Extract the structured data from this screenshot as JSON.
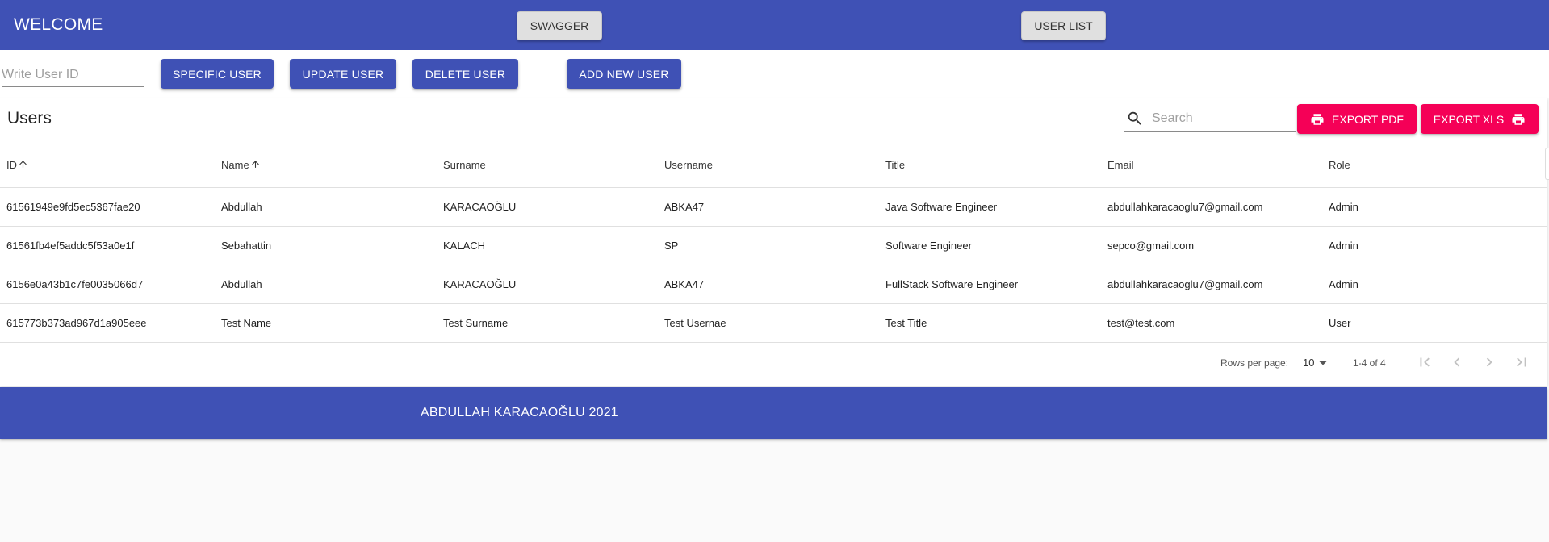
{
  "header": {
    "brand": "WELCOME",
    "swagger_label": "SWAGGER",
    "user_list_label": "USER LIST"
  },
  "actions": {
    "user_id_placeholder": "Write User ID",
    "specific_user_label": "SPECIFIC USER",
    "update_user_label": "UPDATE USER",
    "delete_user_label": "DELETE USER",
    "add_new_user_label": "ADD NEW USER"
  },
  "table_panel": {
    "title": "Users",
    "search_placeholder": "Search",
    "export_pdf_label": "EXPORT PDF",
    "export_xls_label": "EXPORT XLS",
    "columns": [
      "ID",
      "Name",
      "Surname",
      "Username",
      "Title",
      "Email",
      "Role"
    ],
    "rows": [
      [
        "61561949e9fd5ec5367fae20",
        "Abdullah",
        "KARACAOĞLU",
        "ABKA47",
        "Java Software Engineer",
        "abdullahkaracaoglu7@gmail.com",
        "Admin"
      ],
      [
        "61561fb4ef5addc5f53a0e1f",
        "Sebahattin",
        "KALACH",
        "SP",
        "Software Engineer",
        "sepco@gmail.com",
        "Admin"
      ],
      [
        "6156e0a43b1c7fe0035066d7",
        "Abdullah",
        "KARACAOĞLU",
        "ABKA47",
        "FullStack Software Engineer",
        "abdullahkaracaoglu7@gmail.com",
        "Admin"
      ],
      [
        "615773b373ad967d1a905eee",
        "Test Name",
        "Test Surname",
        "Test Usernae",
        "Test Title",
        "test@test.com",
        "User"
      ]
    ],
    "pagination": {
      "rows_per_page_label": "Rows per page:",
      "rows_per_page_value": "10",
      "range_text": "1-4 of 4"
    }
  },
  "footer": {
    "text": "ABDULLAH KARACAOĞLU 2021"
  },
  "colors": {
    "primary": "#3f51b5",
    "accent": "#f50057",
    "background": "#fafafa"
  },
  "icons": [
    "search-icon",
    "printer-icon",
    "arrow-up-icon",
    "dropdown-arrow-icon",
    "first-page-icon",
    "prev-page-icon",
    "next-page-icon",
    "last-page-icon"
  ]
}
